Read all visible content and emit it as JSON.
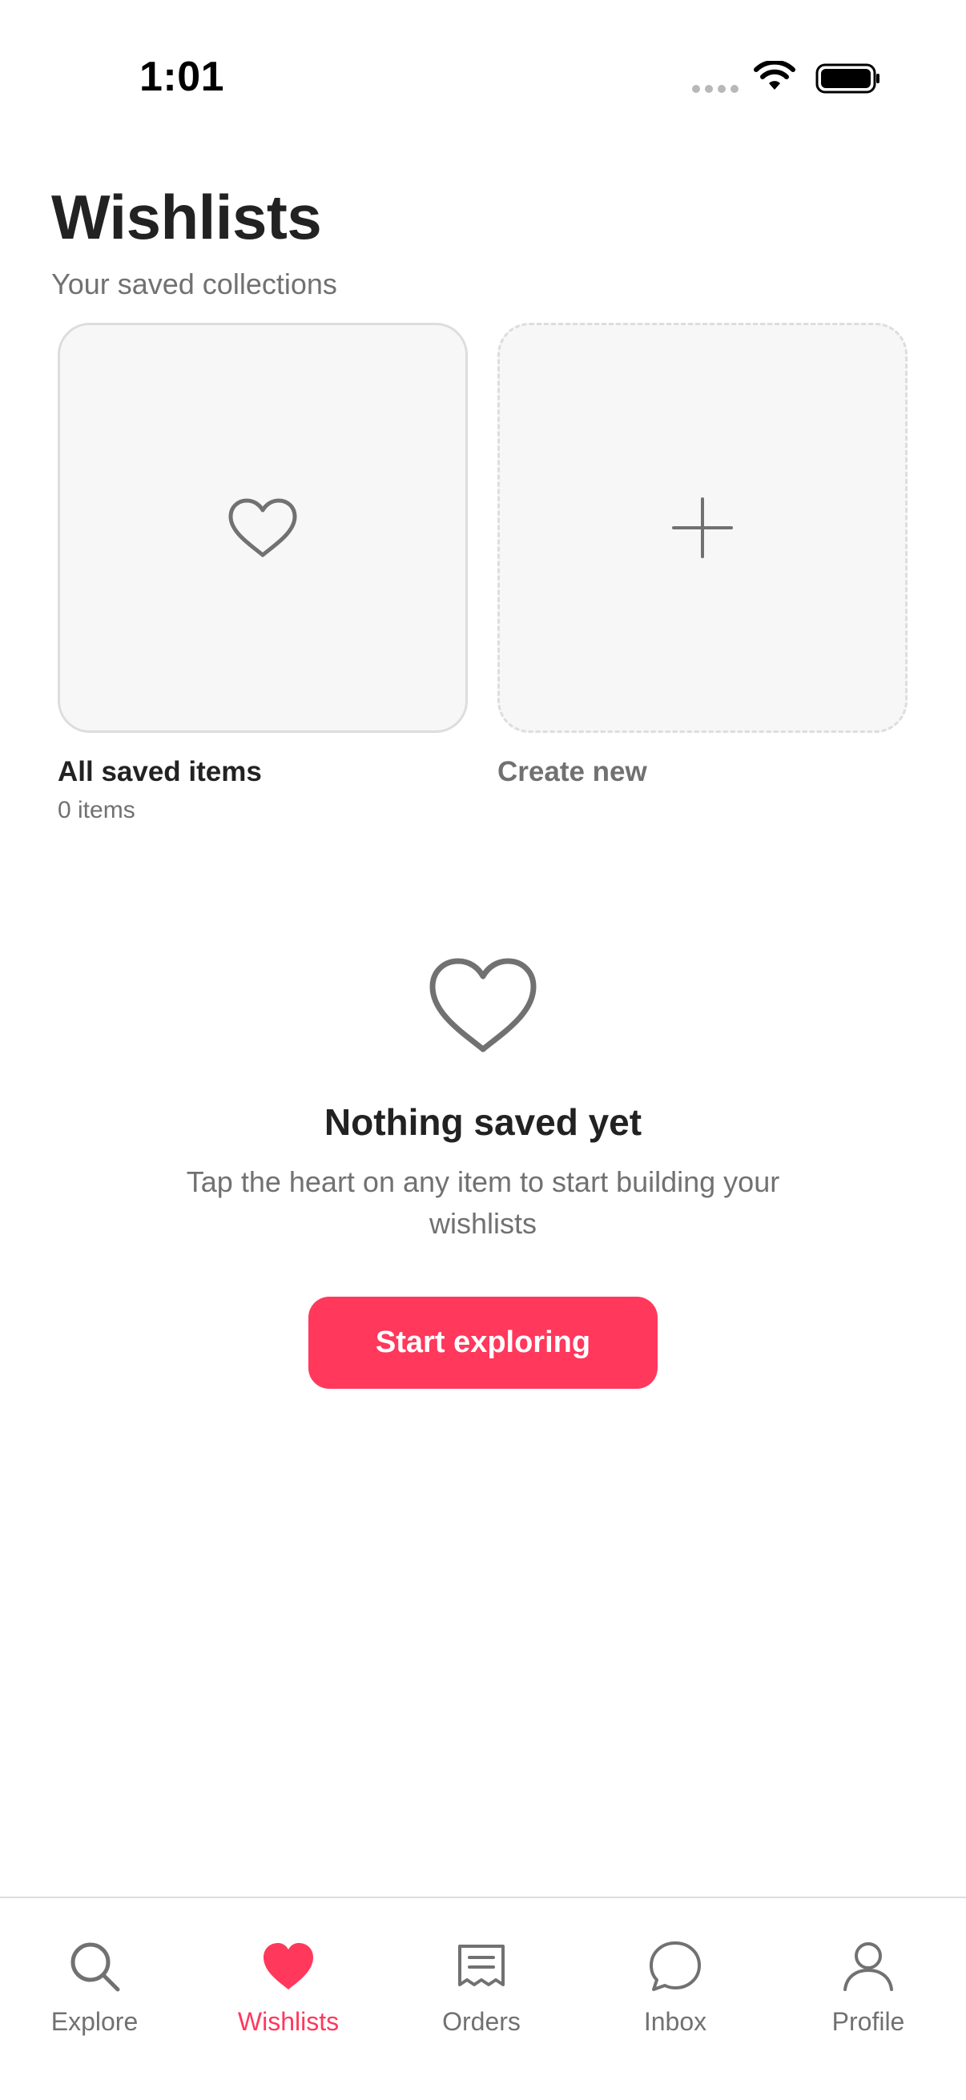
{
  "status_bar": {
    "time": "1:01"
  },
  "header": {
    "title": "Wishlists",
    "subtitle": "Your saved collections"
  },
  "collections": {
    "all_saved": {
      "label": "All saved items",
      "count": "0 items",
      "icon": "heart-outline-icon"
    },
    "create_new": {
      "label": "Create new",
      "icon": "plus-icon"
    }
  },
  "empty_state": {
    "icon": "heart-outline-icon",
    "title": "Nothing saved yet",
    "description": "Tap the heart on any item to start building your wishlists",
    "button_label": "Start exploring"
  },
  "tab_bar": {
    "active": "Wishlists",
    "tabs": [
      {
        "label": "Explore",
        "icon": "search-icon"
      },
      {
        "label": "Wishlists",
        "icon": "heart-filled-icon"
      },
      {
        "label": "Orders",
        "icon": "receipt-icon"
      },
      {
        "label": "Inbox",
        "icon": "chat-bubble-icon"
      },
      {
        "label": "Profile",
        "icon": "person-icon"
      }
    ]
  },
  "colors": {
    "accent": "#ff385c",
    "text_primary": "#222222",
    "text_secondary": "#717171",
    "card_background": "#f7f7f7",
    "border": "#dddddd"
  }
}
